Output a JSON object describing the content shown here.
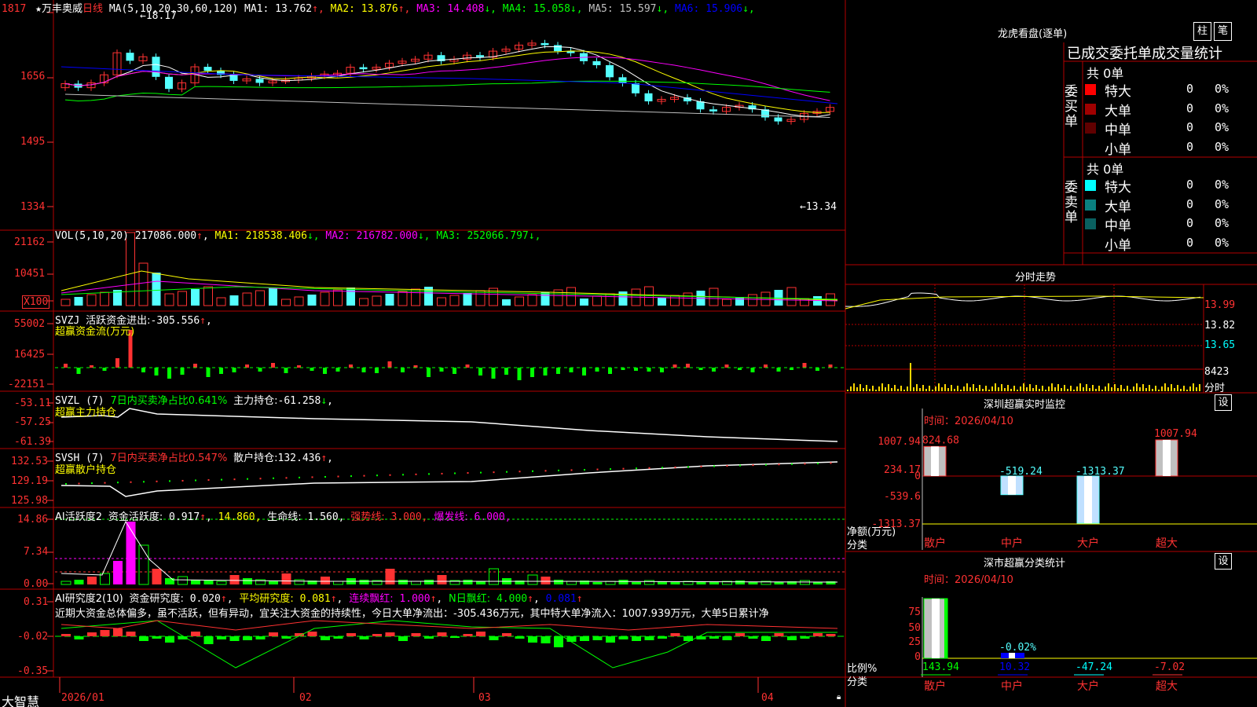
{
  "colors": {
    "up": "#ff3232",
    "down": "#54ffff",
    "grid": "#b40000",
    "axis": "#ff3232",
    "white": "#ffffff",
    "yellow": "#ffff00",
    "magenta": "#ff00ff",
    "green": "#00ff00",
    "blue": "#0000ff",
    "grey": "#c0c0c0",
    "darkred": "#a00000",
    "teal": "#0a8080"
  },
  "stock": {
    "name": "万丰奥威",
    "period": "日线",
    "ma_header": "MA(5,10,20,30,60,120)",
    "ma_values": [
      {
        "label": "MA1:",
        "value": "13.762",
        "arrow": "↑",
        "color": "#ffffff"
      },
      {
        "label": "MA2:",
        "value": "13.876",
        "arrow": "↑",
        "color": "#ffff00"
      },
      {
        "label": "MA3:",
        "value": "14.408",
        "arrow": "↓",
        "color": "#ff00ff"
      },
      {
        "label": "MA4:",
        "value": "15.058",
        "arrow": "↓",
        "color": "#00ff00"
      },
      {
        "label": "MA5:",
        "value": "15.597",
        "arrow": "↓",
        "color": "#c0c0c0"
      },
      {
        "label": "MA6:",
        "value": "15.906",
        "arrow": "↓",
        "color": "#0000ff"
      }
    ],
    "y_ticks": [
      "1817",
      "1656",
      "1495",
      "1334"
    ],
    "high_label": "18.17",
    "low_label": "13.34"
  },
  "vol": {
    "title": "VOL(5,10,20)",
    "value": "217086.000",
    "arrow": "↑",
    "mas": [
      {
        "label": "MA1:",
        "value": "218538.406",
        "arrow": "↓",
        "color": "#ffff00"
      },
      {
        "label": "MA2:",
        "value": "216782.000",
        "arrow": "↓",
        "color": "#ff00ff"
      },
      {
        "label": "MA3:",
        "value": "252066.797",
        "arrow": "↓",
        "color": "#00ff00"
      }
    ],
    "y_ticks": [
      "21162",
      "10451",
      "X100"
    ]
  },
  "svzj": {
    "title": "SVZJ",
    "line1": "活跃资金进出:",
    "value": "-305.556",
    "arrow": "↑",
    "line2": "超赢资金流(万元)",
    "y_ticks": [
      "55002",
      "16425",
      "-22151"
    ]
  },
  "svzl": {
    "title": "SVZL (7)",
    "t1": "7日内买卖净占比0.641%",
    "t2": "主力持仓:",
    "value": "-61.258",
    "arrow": "↓",
    "line2": "超赢主力持仓",
    "y_ticks": [
      "-53.11",
      "-57.25",
      "-61.39"
    ]
  },
  "svsh": {
    "title": "SVSH (7)",
    "t1": "7日内买卖净占比0.547%",
    "t2": "散户持仓:",
    "value": "132.436",
    "arrow": "↑",
    "line2": "超赢散户持仓",
    "y_ticks": [
      "132.53",
      "129.19",
      "125.98"
    ]
  },
  "ai1": {
    "title": "AI活跃度2",
    "l1": "资金活跃度:",
    "v1": "0.917",
    "v1b": "14.860,",
    "l2": "生命线:",
    "v2": "1.560,",
    "l3": "强势线:",
    "v3": "3.000,",
    "l4": "爆发线:",
    "v4": "6.000,",
    "y_ticks": [
      "14.86",
      "7.34",
      "0.00"
    ]
  },
  "ai2": {
    "title": "AI研究度2(10)",
    "l1": "资金研究度:",
    "v1": "0.020",
    "l2": "平均研究度:",
    "v2": "0.081",
    "l3": "连续飘红:",
    "v3": "1.000",
    "l4": "N日飘红:",
    "v4": "4.000",
    "v5": "0.081",
    "comment": "近期大资金总体偏多，虽不活跃，但有异动，宜关注大资金的持续性，今日大单净流出：-305.436万元，其中特大单净流入：1007.939万元，大单5日累计净",
    "y_ticks": [
      "0.31",
      "-0.02",
      "-0.35"
    ]
  },
  "x_axis": {
    "brand": "大智慧",
    "labels": [
      "2026/01",
      "02",
      "03",
      "04"
    ]
  },
  "right": {
    "lhb_title": "龙虎看盘(逐单)",
    "btn_zhu": "柱",
    "btn_bi": "笔",
    "lhb_subtitle": "已成交委托单成交量统计",
    "buy": {
      "side": "委买单",
      "total": "共 0单",
      "rows": [
        {
          "label": "特大",
          "count": "0",
          "pct": "0%",
          "color": "#ff0000"
        },
        {
          "label": "大单",
          "count": "0",
          "pct": "0%",
          "color": "#a00000"
        },
        {
          "label": "中单",
          "count": "0",
          "pct": "0%",
          "color": "#600000"
        },
        {
          "label": "小单",
          "count": "0",
          "pct": "0%",
          "color": ""
        }
      ]
    },
    "sell": {
      "side": "委卖单",
      "total": "共 0单",
      "rows": [
        {
          "label": "特大",
          "count": "0",
          "pct": "0%",
          "color": "#00ffff"
        },
        {
          "label": "大单",
          "count": "0",
          "pct": "0%",
          "color": "#0a8080"
        },
        {
          "label": "中单",
          "count": "0",
          "pct": "0%",
          "color": "#0a6060"
        },
        {
          "label": "小单",
          "count": "0",
          "pct": "0%",
          "color": ""
        }
      ]
    },
    "fs_title": "分时走势",
    "fs_ticks": [
      "13.99",
      "13.82",
      "13.65",
      "8423",
      "分时"
    ],
    "sz_title": "深圳超赢实时监控",
    "set_btn": "设",
    "sz_time": "时间：2026/04/10",
    "sz_ticks": [
      "1007.94",
      "234.17",
      "0",
      "-539.6",
      "-1313.37"
    ],
    "sz_unit": "净额(万元)",
    "sz_cat_label": "分类",
    "sz_bars": [
      {
        "cat": "散户",
        "value": 824.68,
        "label": "824.68"
      },
      {
        "cat": "中户",
        "value": -519.24,
        "label": "-519.24"
      },
      {
        "cat": "大户",
        "value": -1313.37,
        "label": "-1313.37"
      },
      {
        "cat": "超大",
        "value": 1007.94,
        "label": "1007.94"
      }
    ],
    "ss_title": "深市超赢分类统计",
    "ss_time": "时间：2026/04/10",
    "ss_ticks": [
      "75",
      "50",
      "25",
      "0"
    ],
    "ss_unit": "比例%",
    "ss_cat_label": "分类",
    "ss_bars": [
      {
        "cat": "散户",
        "value": 143.94,
        "label": "143.94",
        "label_color": "#00ff00"
      },
      {
        "cat": "中户",
        "value": 10.32,
        "label": "10.32",
        "label_color": "#0000ff",
        "inner_label": "-0.02%"
      },
      {
        "cat": "大户",
        "value": -47.24,
        "label": "-47.24",
        "label_color": "#00ffff"
      },
      {
        "cat": "超大",
        "value": -7.02,
        "label": "-7.02",
        "label_color": "#ff3232"
      }
    ]
  }
}
